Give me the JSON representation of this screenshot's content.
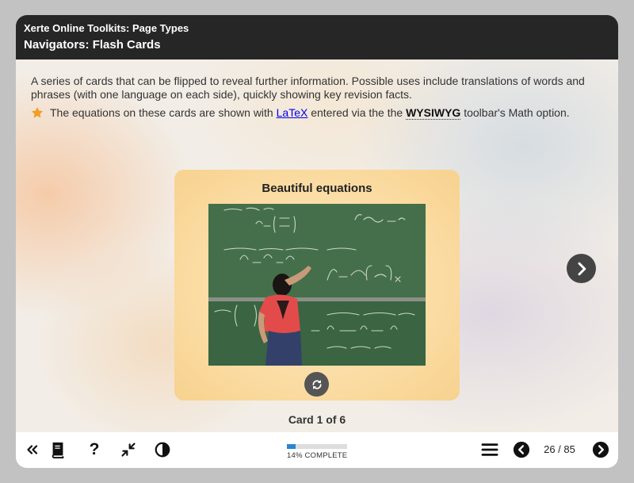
{
  "header": {
    "app_title": "Xerte Online Toolkits: Page Types",
    "page_title": "Navigators: Flash Cards"
  },
  "intro": {
    "text": "A series of cards that can be flipped to reveal further information. Possible uses include translations of words and phrases (with one language on each side), quickly showing key revision facts."
  },
  "note": {
    "prefix": "The equations on these cards are shown with ",
    "link_text": "LaTeX",
    "middle": " entered via the the ",
    "emphasis": "WYSIWYG",
    "suffix": " toolbar's Math option.",
    "icon": "star-icon",
    "icon_color": "#f39c1f"
  },
  "card": {
    "title": "Beautiful equations",
    "counter": "Card 1 of 6"
  },
  "footer": {
    "progress_percent": 14,
    "progress_label": "14% COMPLETE",
    "page_counter": "26 / 85",
    "icons": [
      "double-chevron-left-icon",
      "book-icon",
      "help-icon",
      "compress-icon",
      "contrast-icon",
      "menu-icon",
      "previous-icon",
      "next-icon"
    ]
  },
  "colors": {
    "header_bg": "#262626",
    "progress": "#2a85d0",
    "link": "#0000ee"
  }
}
